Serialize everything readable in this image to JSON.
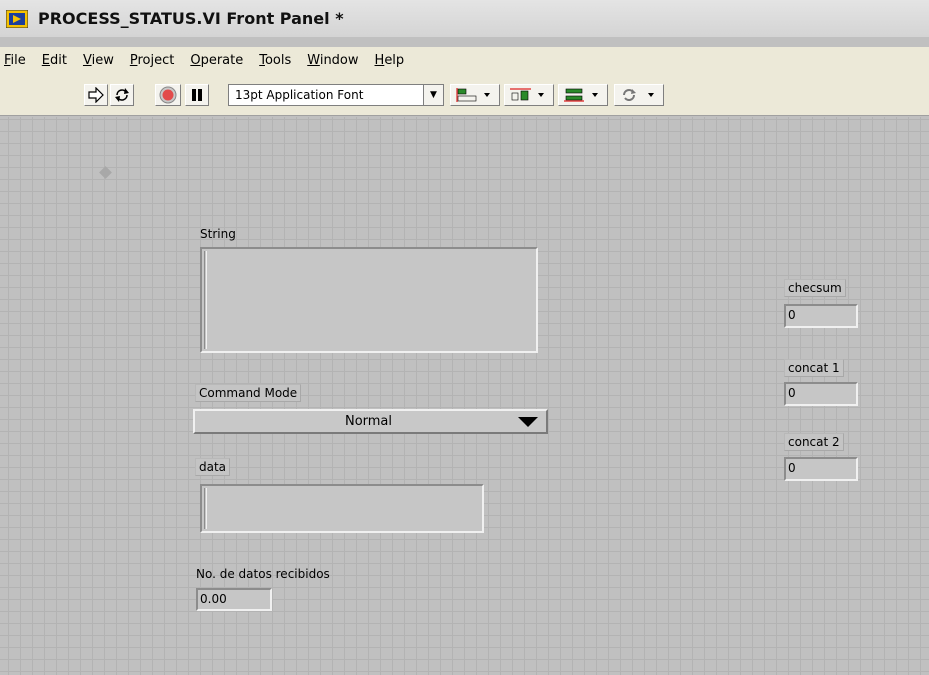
{
  "window": {
    "title": "PROCESS_STATUS.VI Front Panel *"
  },
  "menu": {
    "items": [
      {
        "label": "File",
        "accel": "F",
        "rest": "ile"
      },
      {
        "label": "Edit",
        "accel": "E",
        "rest": "dit"
      },
      {
        "label": "View",
        "accel": "V",
        "rest": "iew"
      },
      {
        "label": "Project",
        "accel": "P",
        "rest": "roject"
      },
      {
        "label": "Operate",
        "accel": "O",
        "rest": "perate"
      },
      {
        "label": "Tools",
        "accel": "T",
        "rest": "ools"
      },
      {
        "label": "Window",
        "accel": "W",
        "rest": "indow"
      },
      {
        "label": "Help",
        "accel": "H",
        "rest": "elp"
      }
    ]
  },
  "toolbar": {
    "font_value": "13pt Application Font",
    "buttons": [
      {
        "name": "run-button",
        "icon": "run-arrow-icon"
      },
      {
        "name": "run-continuously-button",
        "icon": "run-continuously-icon"
      },
      {
        "name": "abort-button",
        "icon": "abort-icon"
      },
      {
        "name": "pause-button",
        "icon": "pause-icon"
      },
      {
        "name": "align-objects-button",
        "icon": "align-objects-icon"
      },
      {
        "name": "distribute-objects-button",
        "icon": "distribute-objects-icon"
      },
      {
        "name": "resize-objects-button",
        "icon": "resize-objects-icon"
      },
      {
        "name": "reorder-button",
        "icon": "reorder-icon"
      }
    ]
  },
  "controls": {
    "string": {
      "label": "String",
      "value": ""
    },
    "command_mode": {
      "label": "Command Mode",
      "value": "Normal"
    },
    "data": {
      "label": "data",
      "value": ""
    },
    "num_datos": {
      "label": "No. de datos recibidos",
      "value": "0.00"
    },
    "checksum": {
      "label": "checsum",
      "value": "0"
    },
    "concat1": {
      "label": "concat 1",
      "value": "0"
    },
    "concat2": {
      "label": "concat 2",
      "value": "0"
    }
  },
  "colors": {
    "panel_bg": "#c0c0c0",
    "abort_red": "#e24b4b",
    "menu_bg": "#ece9d8"
  }
}
